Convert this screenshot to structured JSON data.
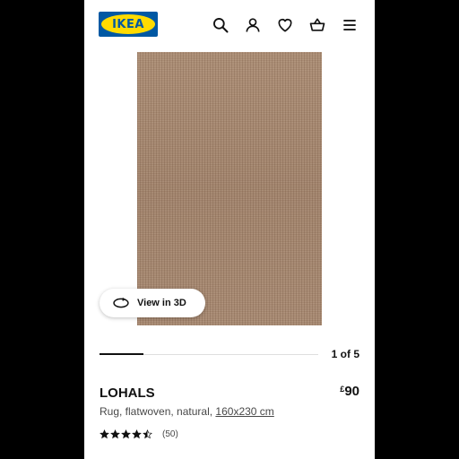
{
  "header": {
    "logo_text": "IKEA",
    "icons": [
      "search-icon",
      "profile-icon",
      "heart-icon",
      "basket-icon",
      "menu-icon"
    ]
  },
  "colors": {
    "brand_blue": "#0058a3",
    "brand_yellow": "#ffdb00",
    "text_primary": "#111111",
    "text_secondary": "#484848"
  },
  "gallery": {
    "view3d_label": "View in 3D",
    "counter": "1 of 5",
    "current": 1,
    "total": 5
  },
  "product": {
    "name": "LOHALS",
    "description": "Rug, flatwoven, natural,",
    "size": "160x230 cm",
    "currency": "£",
    "price": "90",
    "rating": 4.5,
    "review_count": "(50)"
  }
}
